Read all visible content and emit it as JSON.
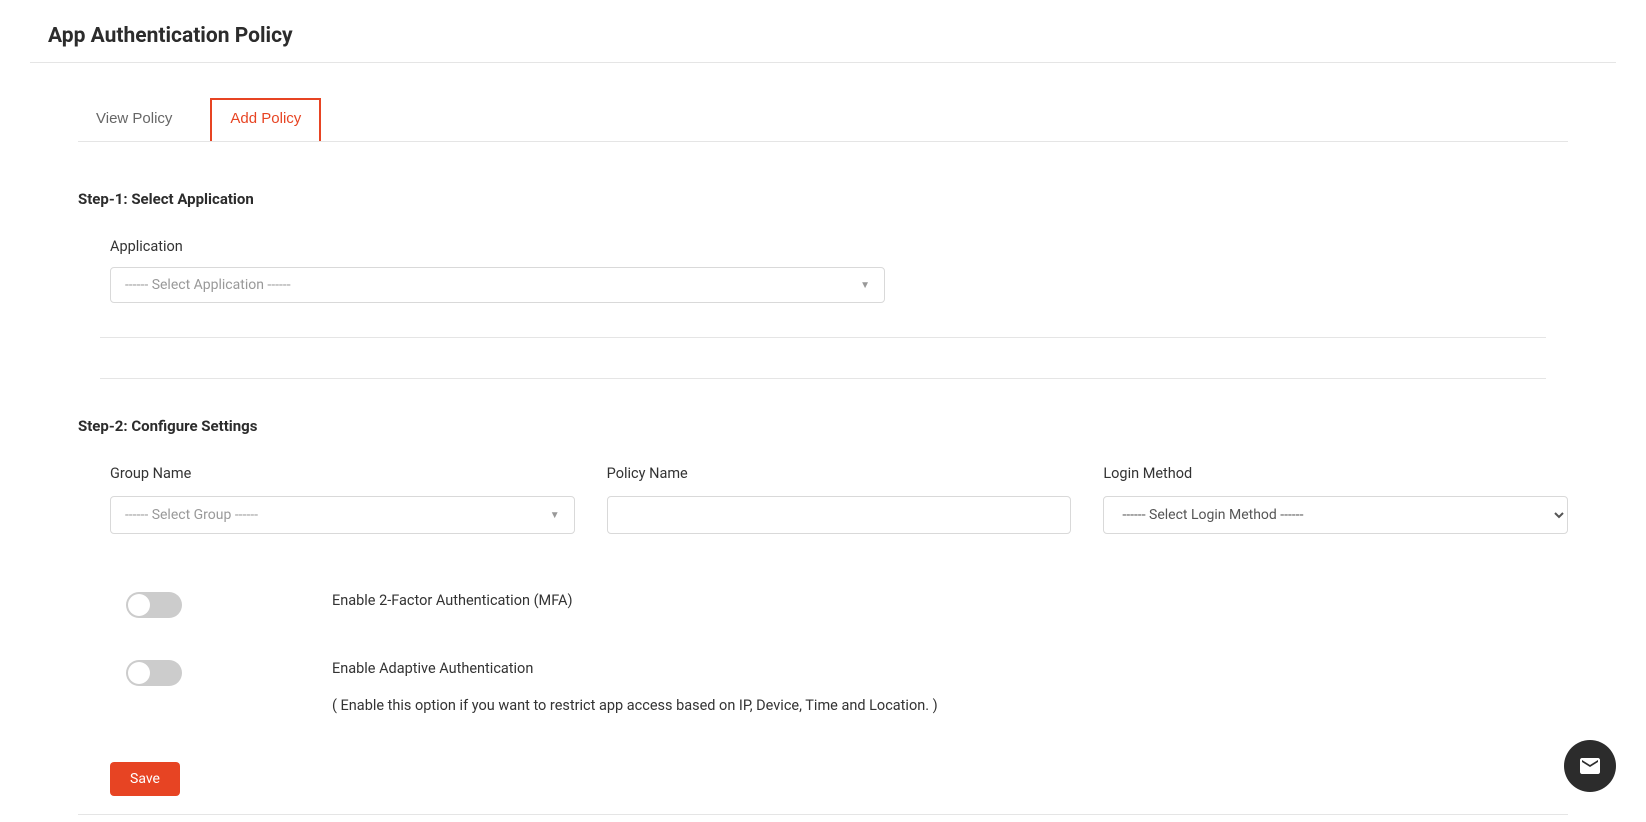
{
  "page": {
    "title": "App Authentication Policy"
  },
  "tabs": [
    {
      "label": "View Policy",
      "active": false
    },
    {
      "label": "Add Policy",
      "active": true
    }
  ],
  "step1": {
    "heading": "Step-1: Select Application",
    "application": {
      "label": "Application",
      "placeholder": "------ Select Application ------"
    }
  },
  "step2": {
    "heading": "Step-2: Configure Settings",
    "group": {
      "label": "Group Name",
      "placeholder": "------ Select Group ------"
    },
    "policy": {
      "label": "Policy Name",
      "value": ""
    },
    "loginMethod": {
      "label": "Login Method",
      "placeholder": "------ Select Login Method ------"
    },
    "mfa": {
      "enabled": false,
      "label": "Enable 2-Factor Authentication (MFA)"
    },
    "adaptive": {
      "enabled": false,
      "label": "Enable Adaptive Authentication",
      "hint": "( Enable this option if you want to restrict app access based on IP, Device, Time and Location. )"
    }
  },
  "actions": {
    "save": "Save"
  }
}
